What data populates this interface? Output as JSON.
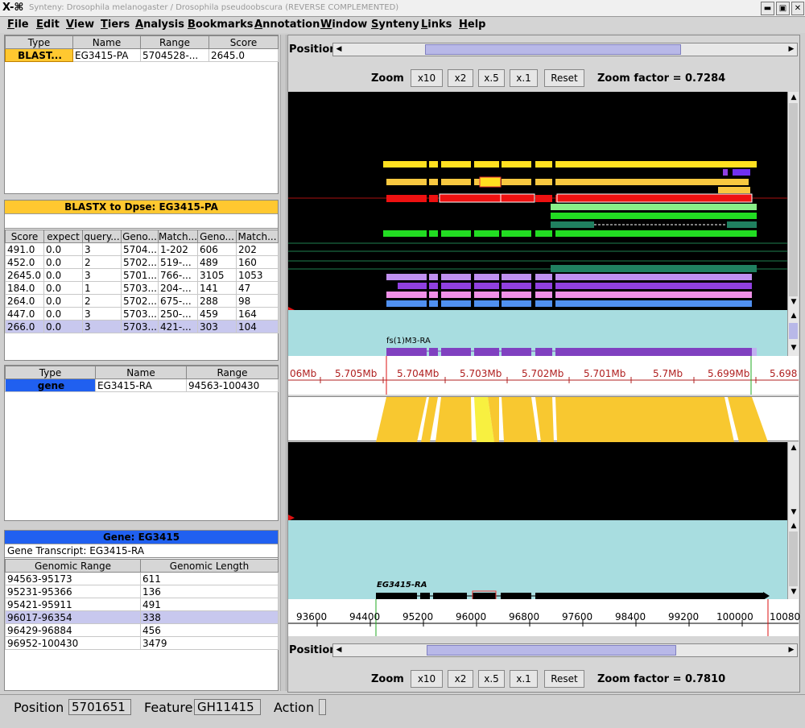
{
  "window": {
    "title": "Synteny: Drosophila melanogaster / Drosophila pseudoobscura (REVERSE COMPLEMENTED)",
    "logo": "X-⌘"
  },
  "menu": [
    "File",
    "Edit",
    "View",
    "Tiers",
    "Analysis",
    "Bookmarks",
    "Annotation",
    "Window",
    "Synteny",
    "Links",
    "Help"
  ],
  "top_table": {
    "headers": [
      "Type",
      "Name",
      "Range",
      "Score"
    ],
    "rows": [
      [
        "BLAST...",
        "EG3415-PA",
        "5704528-...",
        "2645.0"
      ]
    ]
  },
  "blast_panel": {
    "title": "BLASTX to Dpse:  EG3415-PA",
    "headers": [
      "Score",
      "expect",
      "query...",
      "Geno...",
      "Match...",
      "Geno...",
      "Match..."
    ],
    "rows": [
      [
        "491.0",
        "0.0",
        "3",
        "5704...",
        "1-202",
        "606",
        "202"
      ],
      [
        "452.0",
        "0.0",
        "2",
        "5702...",
        "519-...",
        "489",
        "160"
      ],
      [
        "2645.0",
        "0.0",
        "3",
        "5701...",
        "766-...",
        "3105",
        "1053"
      ],
      [
        "184.0",
        "0.0",
        "1",
        "5703...",
        "204-...",
        "141",
        "47"
      ],
      [
        "264.0",
        "0.0",
        "2",
        "5702...",
        "675-...",
        "288",
        "98"
      ],
      [
        "447.0",
        "0.0",
        "3",
        "5703...",
        "250-...",
        "459",
        "164"
      ],
      [
        "266.0",
        "0.0",
        "3",
        "5703...",
        "421-...",
        "303",
        "104"
      ]
    ]
  },
  "gene_table": {
    "headers": [
      "Type",
      "Name",
      "Range"
    ],
    "rows": [
      [
        "gene",
        "EG3415-RA",
        "94563-100430"
      ]
    ]
  },
  "gene_panel": {
    "title": "Gene:  EG3415",
    "transcript_label": "Gene Transcript:  EG3415-RA",
    "headers": [
      "Genomic Range",
      "Genomic Length"
    ],
    "rows": [
      [
        "94563-95173",
        "611"
      ],
      [
        "95231-95366",
        "136"
      ],
      [
        "95421-95911",
        "491"
      ],
      [
        "96017-96354",
        "338"
      ],
      [
        "96429-96884",
        "456"
      ],
      [
        "96952-100430",
        "3479"
      ]
    ]
  },
  "top_view": {
    "position_label": "Position",
    "zoom_label": "Zoom",
    "buttons": [
      "x10",
      "x2",
      "x.5",
      "x.1",
      "Reset"
    ],
    "zoom_factor": "Zoom factor = 0.7284",
    "gene_label": "fs(1)M3-RA",
    "ruler": [
      "06Mb",
      "5.705Mb",
      "5.704Mb",
      "5.703Mb",
      "5.702Mb",
      "5.701Mb",
      "5.7Mb",
      "5.699Mb",
      "5.698"
    ]
  },
  "bottom_view": {
    "position_label": "Position",
    "zoom_label": "Zoom",
    "buttons": [
      "x10",
      "x2",
      "x.5",
      "x.1",
      "Reset"
    ],
    "zoom_factor": "Zoom factor = 0.7810",
    "gene_label": "EG3415-RA",
    "ruler": [
      "93600",
      "94400",
      "95200",
      "96000",
      "96800",
      "97600",
      "98400",
      "99200",
      "100000",
      "10080"
    ]
  },
  "status": {
    "position_label": "Position",
    "position_value": "5701651",
    "feature_label": "Feature",
    "feature_value": "GH11415",
    "action_label": "Action",
    "action_value": ""
  },
  "colors": {
    "blast_yellow": "#ffe020",
    "blast_orange": "#f8c840",
    "blast_red": "#ee1111",
    "blast_green": "#22dd22",
    "blast_lightgreen": "#88ee88",
    "blast_darkgreen": "#208060",
    "blast_violet": "#c090f0",
    "blast_purple": "#9040e0",
    "blast_pink": "#f090e8",
    "blast_blue": "#5090f0",
    "selection_blue": "#2060f0",
    "panel_header_yellow": "#ffc830",
    "gene_purple": "#8040c0",
    "cyan_bg": "#a8dde0",
    "synteny_yellow": "#f8c830"
  }
}
